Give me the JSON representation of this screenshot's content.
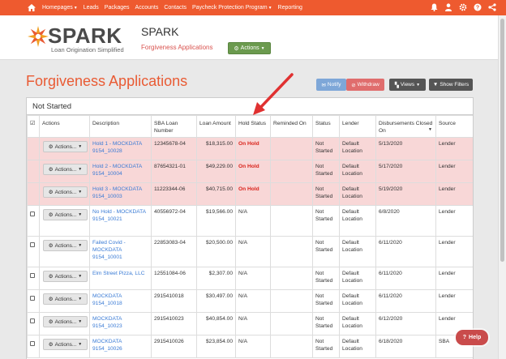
{
  "nav": {
    "items": [
      "Homepages",
      "Leads",
      "Packages",
      "Accounts",
      "Contacts",
      "Paycheck Protection Program",
      "Reporting"
    ],
    "carets": [
      true,
      false,
      false,
      false,
      false,
      true,
      false
    ]
  },
  "header": {
    "logo_word": "SPARK",
    "logo_tag": "Loan Origination Simplified",
    "title": "SPARK",
    "subtitle": "Forgiveness Applications",
    "actions_label": "Actions"
  },
  "page": {
    "title": "Forgiveness Applications",
    "buttons": {
      "notify": "Notify",
      "withdraw": "Withdraw",
      "views": "Views",
      "show_filters": "Show Filters"
    },
    "panel_title": "Not Started"
  },
  "table": {
    "headers": {
      "actions": "Actions",
      "description": "Description",
      "sba_loan_number": "SBA Loan Number",
      "loan_amount": "Loan Amount",
      "hold_status": "Hold Status",
      "reminded_on": "Reminded On",
      "status": "Status",
      "lender": "Lender",
      "disbursements": "Disbursements Closed On",
      "source": "Source"
    },
    "action_label": "Actions...",
    "rows": [
      {
        "hold": true,
        "description": "Hold 1 - MOCKDATA 9154_10028",
        "sba": "12345678-04",
        "amount": "$18,315.00",
        "hold_status": "On Hold",
        "reminded": "",
        "status": "Not Started",
        "lender": "Default Location",
        "disb": "5/13/2020",
        "source": "Lender"
      },
      {
        "hold": true,
        "description": "Hold 2 - MOCKDATA 9154_10004",
        "sba": "87654321-01",
        "amount": "$49,229.00",
        "hold_status": "On Hold",
        "reminded": "",
        "status": "Not Started",
        "lender": "Default Location",
        "disb": "5/17/2020",
        "source": "Lender"
      },
      {
        "hold": true,
        "description": "Hold 3 - MOCKDATA 9154_10003",
        "sba": "11223344-06",
        "amount": "$40,715.00",
        "hold_status": "On Hold",
        "reminded": "",
        "status": "Not Started",
        "lender": "Default Location",
        "disb": "5/19/2020",
        "source": "Lender"
      },
      {
        "hold": false,
        "description": "No Hold - MOCKDATA 9154_10021",
        "sba": "40556972-04",
        "amount": "$19,566.00",
        "hold_status": "N/A",
        "reminded": "",
        "status": "Not Started",
        "lender": "Default Location",
        "disb": "6/8/2020",
        "source": "Lender"
      },
      {
        "hold": false,
        "description": "Failed Covid - MOCKDATA 9154_10001",
        "sba": "22853083-04",
        "amount": "$20,500.00",
        "hold_status": "N/A",
        "reminded": "",
        "status": "Not Started",
        "lender": "Default Location",
        "disb": "6/11/2020",
        "source": "Lender"
      },
      {
        "hold": false,
        "description": "Elm Street Pizza, LLC",
        "sba": "12551084-06",
        "amount": "$2,307.00",
        "hold_status": "N/A",
        "reminded": "",
        "status": "Not Started",
        "lender": "Default Location",
        "disb": "6/11/2020",
        "source": "Lender"
      },
      {
        "hold": false,
        "description": "MOCKDATA 9154_10018",
        "sba": "2915410018",
        "amount": "$30,497.00",
        "hold_status": "N/A",
        "reminded": "",
        "status": "Not Started",
        "lender": "Default Location",
        "disb": "6/11/2020",
        "source": "Lender"
      },
      {
        "hold": false,
        "description": "MOCKDATA 9154_10023",
        "sba": "2915410023",
        "amount": "$40,854.00",
        "hold_status": "N/A",
        "reminded": "",
        "status": "Not Started",
        "lender": "Default Location",
        "disb": "6/12/2020",
        "source": "Lender"
      },
      {
        "hold": false,
        "description": "MOCKDATA 9154_10026",
        "sba": "2915410026",
        "amount": "$23,854.00",
        "hold_status": "N/A",
        "reminded": "",
        "status": "Not Started",
        "lender": "Default Location",
        "disb": "6/18/2020",
        "source": "SBA"
      }
    ]
  },
  "help": {
    "label": "Help"
  },
  "colors": {
    "nav_bg": "#ee5a2f",
    "title": "#e95b34",
    "hold_row": "#f8d7d7",
    "on_hold_text": "#d9241c",
    "link": "#3a7bd5",
    "actions_green": "#6b9a4e"
  },
  "icons": {
    "nav": [
      "home-icon",
      "bell-icon",
      "user-icon",
      "gear-icon",
      "question-icon",
      "share-icon"
    ],
    "buttons": [
      "envelope-icon",
      "ban-icon",
      "binoculars-icon",
      "filter-icon",
      "gears-icon"
    ]
  }
}
